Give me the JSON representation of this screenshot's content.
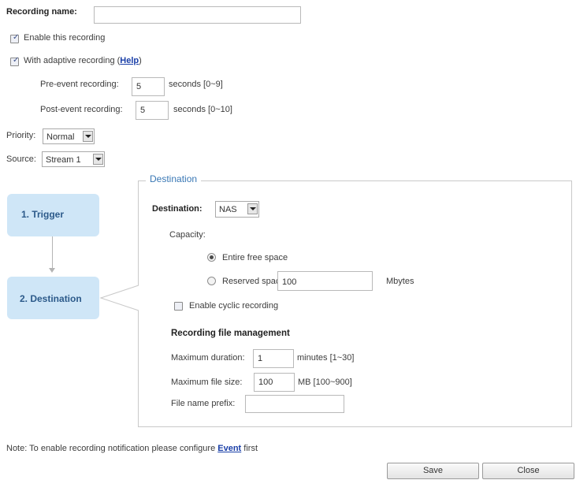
{
  "recording_name": {
    "label": "Recording name:",
    "value": ""
  },
  "enable_recording": {
    "label": "Enable this recording",
    "checked": true
  },
  "adaptive": {
    "label_prefix": "With adaptive recording (",
    "help": "Help",
    "label_suffix": ")",
    "checked": true
  },
  "pre_event": {
    "label": "Pre-event recording:",
    "value": "5",
    "unit": "seconds [0~9]"
  },
  "post_event": {
    "label": "Post-event recording:",
    "value": "5",
    "unit": "seconds [0~10]"
  },
  "priority": {
    "label": "Priority:",
    "value": "Normal"
  },
  "source": {
    "label": "Source:",
    "value": "Stream 1"
  },
  "steps": [
    {
      "label": "1. Trigger"
    },
    {
      "label": "2. Destination"
    }
  ],
  "destination_panel": {
    "legend": "Destination",
    "destination_label": "Destination:",
    "destination_value": "NAS",
    "capacity_label": "Capacity:",
    "entire_free_space": {
      "label": "Entire free space",
      "selected": true
    },
    "reserved_space": {
      "label": "Reserved space:",
      "value": "100",
      "unit": "Mbytes",
      "selected": false
    },
    "cyclic": {
      "label": "Enable cyclic recording",
      "checked": false
    },
    "file_management": {
      "heading": "Recording file management",
      "max_duration": {
        "label": "Maximum duration:",
        "value": "1",
        "unit": "minutes [1~30]"
      },
      "max_file_size": {
        "label": "Maximum file size:",
        "value": "100",
        "unit": "MB [100~900]"
      },
      "file_name_prefix": {
        "label": "File name prefix:",
        "value": ""
      }
    }
  },
  "note": {
    "prefix": "Note: To enable recording notification please configure ",
    "link": "Event",
    "suffix": " first"
  },
  "buttons": {
    "save": "Save",
    "close": "Close"
  }
}
